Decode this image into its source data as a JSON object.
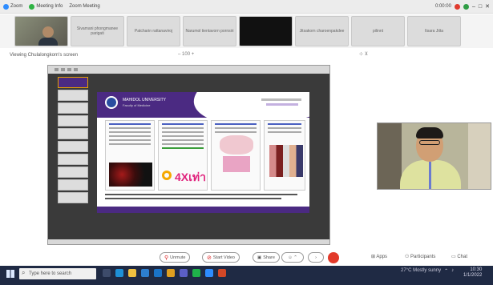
{
  "topbar": {
    "zoom_label": "Zoom",
    "meeting_label": "Meeting Info",
    "meeting_menu": "Zoom Meeting",
    "right_text": "0:00:00"
  },
  "participants": [
    {
      "name": "",
      "type": "video"
    },
    {
      "name": "Sivamani phongmanee parigati",
      "type": "name"
    },
    {
      "name": "Patcharin rattanaviroj",
      "type": "name"
    },
    {
      "name": "Narumol tientavorn pornsiri",
      "type": "name"
    },
    {
      "name": "",
      "type": "black"
    },
    {
      "name": "Jitsakorn charoenpakdee",
      "type": "name"
    },
    {
      "name": "pilinnt",
      "type": "name"
    },
    {
      "name": "Itsara Jitta",
      "type": "name"
    }
  ],
  "view": {
    "title": "Viewing Chulalongkorn's screen",
    "zoom": "100",
    "tools": "⊹  ⊻"
  },
  "slide": {
    "university": "MAHIDOL UNIVERSITY",
    "university_sub": "Faculty of Medicine",
    "figure_text": "4Xเท่า"
  },
  "controls": {
    "unmute": "Unmute",
    "start_video": "Start Video",
    "share": "Share",
    "apps": "Apps",
    "participants": "Participants",
    "chat": "Chat"
  },
  "taskbar": {
    "search_placeholder": "Type here to search",
    "time": "10:30",
    "date": "1/1/2022",
    "weather": "27°C Mostly sunny"
  }
}
